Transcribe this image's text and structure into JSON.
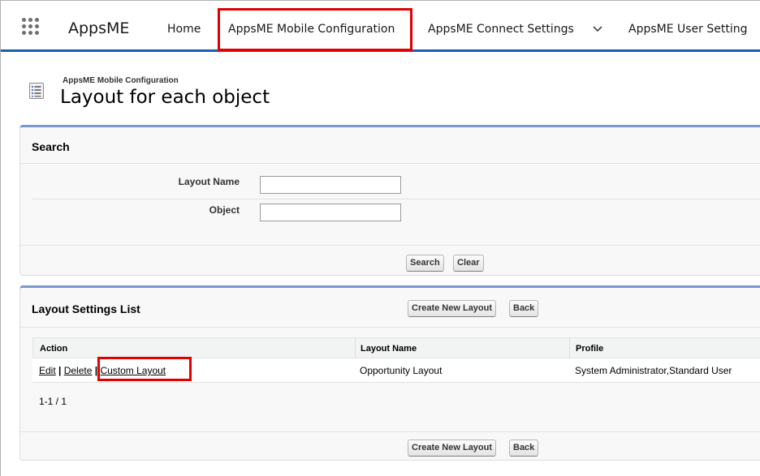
{
  "nav": {
    "app_name": "AppsME",
    "items": {
      "home": "Home",
      "mobile_config": "AppsME Mobile Configuration",
      "connect_settings": "AppsME Connect Settings",
      "user_setting": "AppsME User Setting"
    }
  },
  "header": {
    "eyebrow": "AppsME Mobile Configuration",
    "title": "Layout for each object"
  },
  "search": {
    "title": "Search",
    "layout_name_label": "Layout Name",
    "layout_name_value": "",
    "object_label": "Object",
    "object_value": "",
    "search_button": "Search",
    "clear_button": "Clear"
  },
  "list": {
    "title": "Layout Settings List",
    "create_button": "Create New Layout",
    "back_button": "Back",
    "columns": {
      "action": "Action",
      "layout_name": "Layout Name",
      "profile": "Profile"
    },
    "rows": [
      {
        "edit": "Edit",
        "delete": "Delete",
        "custom": "Custom Layout",
        "layout_name": "Opportunity Layout",
        "profile": "System Administrator,Standard User"
      }
    ],
    "pager": "1-1 / 1"
  },
  "colors": {
    "nav_underline": "#1b5fb4",
    "panel_accent": "#7b98cc",
    "highlight": "#e00000"
  },
  "icons": {
    "launcher": "app-launcher-grid-icon",
    "page": "list-icon",
    "chevron": "chevron-down-icon"
  }
}
